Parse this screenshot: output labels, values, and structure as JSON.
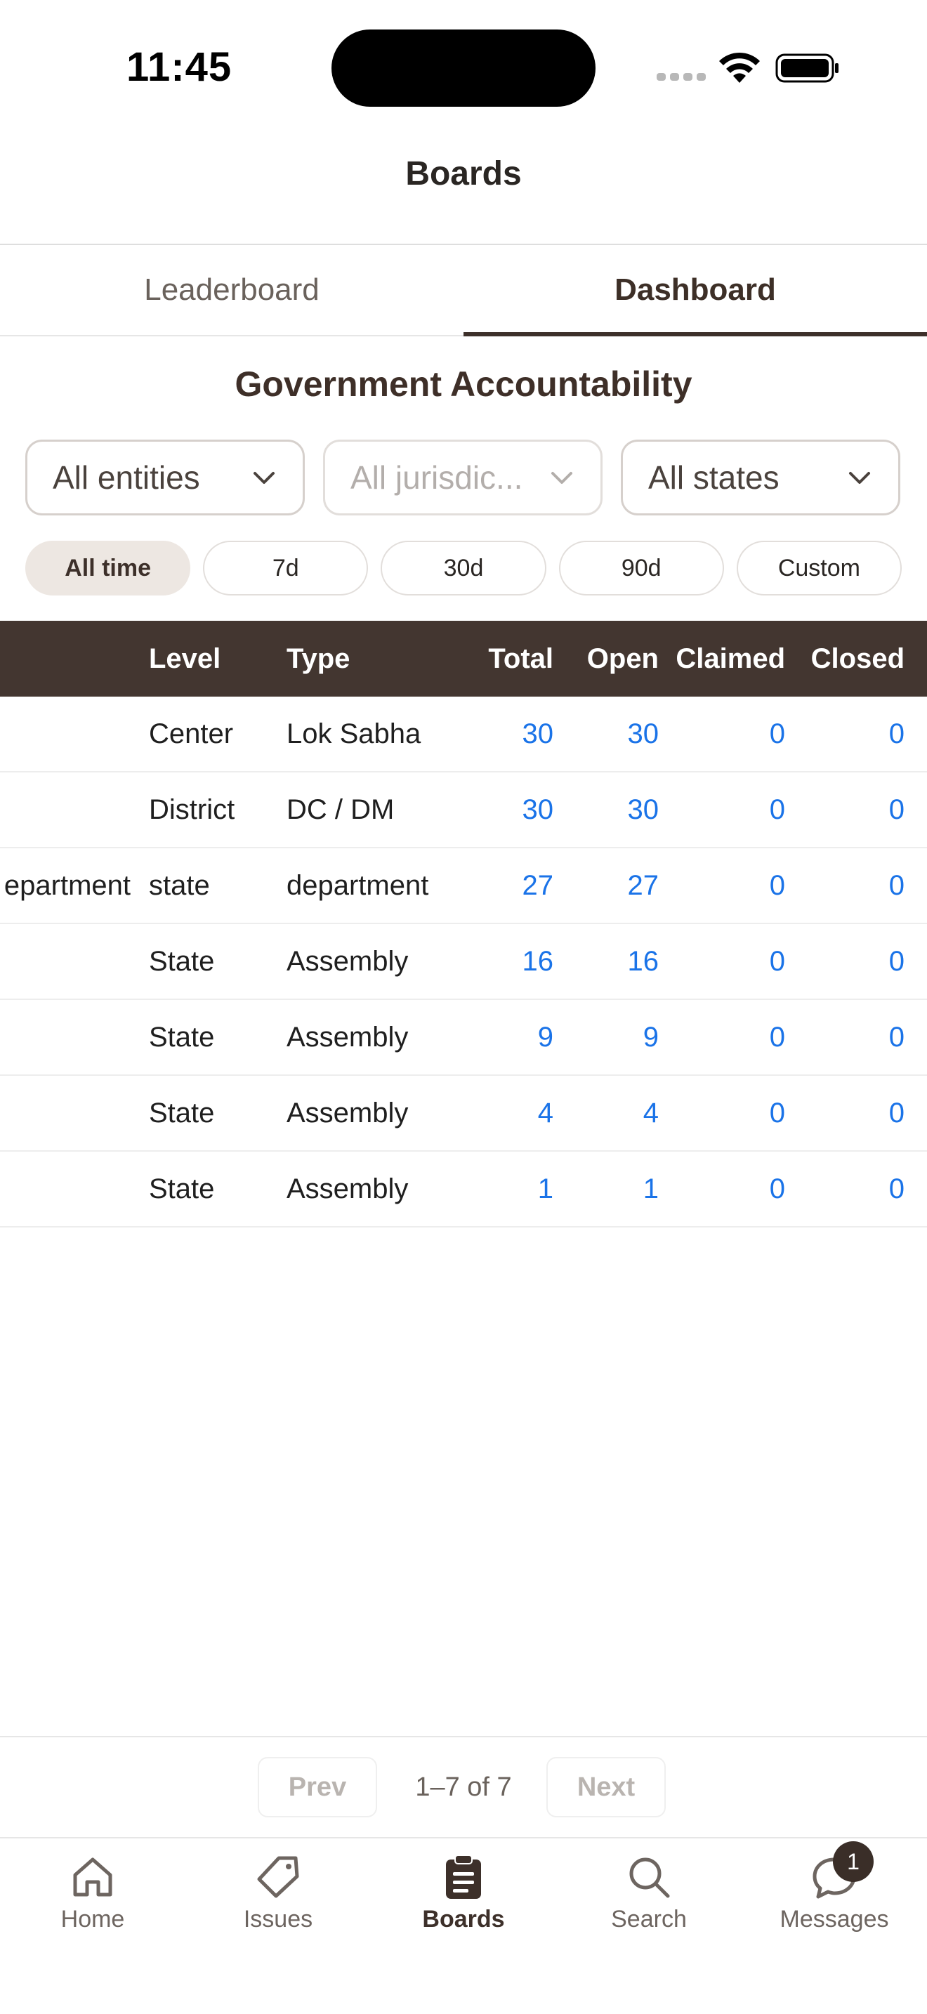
{
  "status_bar": {
    "time": "11:45"
  },
  "nav": {
    "title": "Boards"
  },
  "tabs": [
    {
      "label": "Leaderboard",
      "active": false
    },
    {
      "label": "Dashboard",
      "active": true
    }
  ],
  "section_title": "Government Accountability",
  "filters": {
    "entities": "All entities",
    "jurisdictions": "All jurisdic...",
    "states": "All states"
  },
  "time_ranges": [
    "All time",
    "7d",
    "30d",
    "90d",
    "Custom"
  ],
  "table": {
    "headers": {
      "name": "",
      "level": "Level",
      "type": "Type",
      "total": "Total",
      "open": "Open",
      "claimed": "Claimed",
      "closed": "Closed"
    },
    "rows": [
      {
        "name": "",
        "level": "Center",
        "type": "Lok Sabha",
        "total": "30",
        "open": "30",
        "claimed": "0",
        "closed": "0"
      },
      {
        "name": "",
        "level": "District",
        "type": "DC / DM",
        "total": "30",
        "open": "30",
        "claimed": "0",
        "closed": "0"
      },
      {
        "name": "epartment",
        "level": "state",
        "type": "department",
        "total": "27",
        "open": "27",
        "claimed": "0",
        "closed": "0"
      },
      {
        "name": "",
        "level": "State",
        "type": "Assembly",
        "total": "16",
        "open": "16",
        "claimed": "0",
        "closed": "0"
      },
      {
        "name": "",
        "level": "State",
        "type": "Assembly",
        "total": "9",
        "open": "9",
        "claimed": "0",
        "closed": "0"
      },
      {
        "name": "",
        "level": "State",
        "type": "Assembly",
        "total": "4",
        "open": "4",
        "claimed": "0",
        "closed": "0"
      },
      {
        "name": "",
        "level": "State",
        "type": "Assembly",
        "total": "1",
        "open": "1",
        "claimed": "0",
        "closed": "0"
      }
    ]
  },
  "pagination": {
    "prev": "Prev",
    "info": "1–7 of 7",
    "next": "Next"
  },
  "bottom_nav": {
    "home": "Home",
    "issues": "Issues",
    "boards": "Boards",
    "search": "Search",
    "messages": "Messages",
    "messages_badge": "1"
  },
  "colors": {
    "brand_dark": "#433630",
    "link_blue": "#1a73e8",
    "chip_active": "#ede7e2"
  }
}
